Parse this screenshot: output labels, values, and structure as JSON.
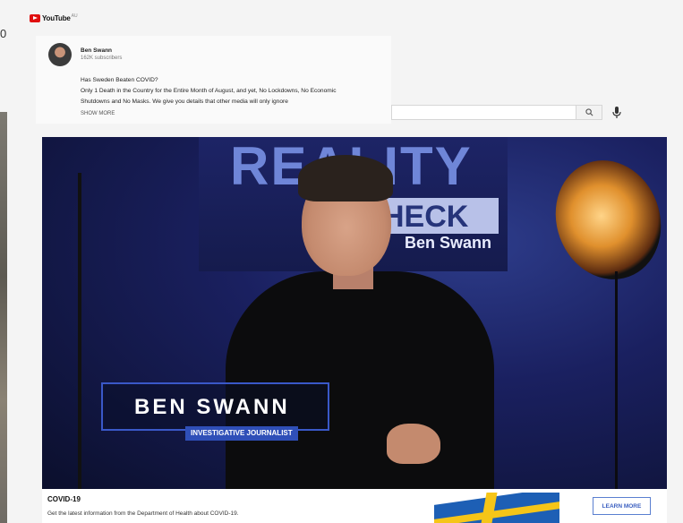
{
  "corner_char": "0",
  "logo": {
    "text": "YouTube",
    "region": "AU"
  },
  "channel": {
    "name": "Ben Swann",
    "subscribers": "162K subscribers",
    "description_lines": [
      "Has Sweden Beaten COVID?",
      "Only 1 Death in the Country for the Entire Month of August, and yet, No Lockdowns, No Economic",
      "Shutdowns and No Masks.  We give you details that other media will only ignore"
    ],
    "show_more": "SHOW MORE"
  },
  "search": {
    "placeholder": ""
  },
  "video": {
    "backdrop_title": "REALITY",
    "backdrop_check": "HECK",
    "backdrop_sub": "Ben Swann",
    "lower_third_name": "BEN SWANN",
    "lower_third_role": "INVESTIGATIVE JOURNALIST"
  },
  "ad": {
    "title": "COVID-19",
    "description": "Get the latest information from the Department of Health about COVID-19.",
    "button": "LEARN MORE"
  },
  "icons": [
    "youtube-logo-icon",
    "search-icon",
    "microphone-icon",
    "sweden-flag-icon"
  ]
}
